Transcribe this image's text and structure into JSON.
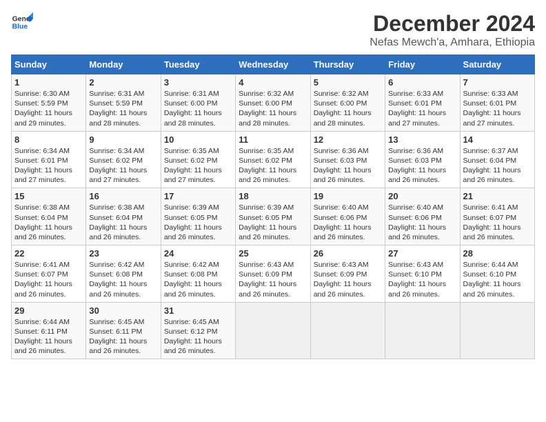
{
  "logo": {
    "line1": "General",
    "line2": "Blue"
  },
  "title": "December 2024",
  "subtitle": "Nefas Mewch'a, Amhara, Ethiopia",
  "days_of_week": [
    "Sunday",
    "Monday",
    "Tuesday",
    "Wednesday",
    "Thursday",
    "Friday",
    "Saturday"
  ],
  "weeks": [
    [
      {
        "day": 1,
        "sunrise": "6:30 AM",
        "sunset": "5:59 PM",
        "daylight": "11 hours and 29 minutes"
      },
      {
        "day": 2,
        "sunrise": "6:31 AM",
        "sunset": "5:59 PM",
        "daylight": "11 hours and 28 minutes"
      },
      {
        "day": 3,
        "sunrise": "6:31 AM",
        "sunset": "6:00 PM",
        "daylight": "11 hours and 28 minutes"
      },
      {
        "day": 4,
        "sunrise": "6:32 AM",
        "sunset": "6:00 PM",
        "daylight": "11 hours and 28 minutes"
      },
      {
        "day": 5,
        "sunrise": "6:32 AM",
        "sunset": "6:00 PM",
        "daylight": "11 hours and 28 minutes"
      },
      {
        "day": 6,
        "sunrise": "6:33 AM",
        "sunset": "6:01 PM",
        "daylight": "11 hours and 27 minutes"
      },
      {
        "day": 7,
        "sunrise": "6:33 AM",
        "sunset": "6:01 PM",
        "daylight": "11 hours and 27 minutes"
      }
    ],
    [
      {
        "day": 8,
        "sunrise": "6:34 AM",
        "sunset": "6:01 PM",
        "daylight": "11 hours and 27 minutes"
      },
      {
        "day": 9,
        "sunrise": "6:34 AM",
        "sunset": "6:02 PM",
        "daylight": "11 hours and 27 minutes"
      },
      {
        "day": 10,
        "sunrise": "6:35 AM",
        "sunset": "6:02 PM",
        "daylight": "11 hours and 27 minutes"
      },
      {
        "day": 11,
        "sunrise": "6:35 AM",
        "sunset": "6:02 PM",
        "daylight": "11 hours and 26 minutes"
      },
      {
        "day": 12,
        "sunrise": "6:36 AM",
        "sunset": "6:03 PM",
        "daylight": "11 hours and 26 minutes"
      },
      {
        "day": 13,
        "sunrise": "6:36 AM",
        "sunset": "6:03 PM",
        "daylight": "11 hours and 26 minutes"
      },
      {
        "day": 14,
        "sunrise": "6:37 AM",
        "sunset": "6:04 PM",
        "daylight": "11 hours and 26 minutes"
      }
    ],
    [
      {
        "day": 15,
        "sunrise": "6:38 AM",
        "sunset": "6:04 PM",
        "daylight": "11 hours and 26 minutes"
      },
      {
        "day": 16,
        "sunrise": "6:38 AM",
        "sunset": "6:04 PM",
        "daylight": "11 hours and 26 minutes"
      },
      {
        "day": 17,
        "sunrise": "6:39 AM",
        "sunset": "6:05 PM",
        "daylight": "11 hours and 26 minutes"
      },
      {
        "day": 18,
        "sunrise": "6:39 AM",
        "sunset": "6:05 PM",
        "daylight": "11 hours and 26 minutes"
      },
      {
        "day": 19,
        "sunrise": "6:40 AM",
        "sunset": "6:06 PM",
        "daylight": "11 hours and 26 minutes"
      },
      {
        "day": 20,
        "sunrise": "6:40 AM",
        "sunset": "6:06 PM",
        "daylight": "11 hours and 26 minutes"
      },
      {
        "day": 21,
        "sunrise": "6:41 AM",
        "sunset": "6:07 PM",
        "daylight": "11 hours and 26 minutes"
      }
    ],
    [
      {
        "day": 22,
        "sunrise": "6:41 AM",
        "sunset": "6:07 PM",
        "daylight": "11 hours and 26 minutes"
      },
      {
        "day": 23,
        "sunrise": "6:42 AM",
        "sunset": "6:08 PM",
        "daylight": "11 hours and 26 minutes"
      },
      {
        "day": 24,
        "sunrise": "6:42 AM",
        "sunset": "6:08 PM",
        "daylight": "11 hours and 26 minutes"
      },
      {
        "day": 25,
        "sunrise": "6:43 AM",
        "sunset": "6:09 PM",
        "daylight": "11 hours and 26 minutes"
      },
      {
        "day": 26,
        "sunrise": "6:43 AM",
        "sunset": "6:09 PM",
        "daylight": "11 hours and 26 minutes"
      },
      {
        "day": 27,
        "sunrise": "6:43 AM",
        "sunset": "6:10 PM",
        "daylight": "11 hours and 26 minutes"
      },
      {
        "day": 28,
        "sunrise": "6:44 AM",
        "sunset": "6:10 PM",
        "daylight": "11 hours and 26 minutes"
      }
    ],
    [
      {
        "day": 29,
        "sunrise": "6:44 AM",
        "sunset": "6:11 PM",
        "daylight": "11 hours and 26 minutes"
      },
      {
        "day": 30,
        "sunrise": "6:45 AM",
        "sunset": "6:11 PM",
        "daylight": "11 hours and 26 minutes"
      },
      {
        "day": 31,
        "sunrise": "6:45 AM",
        "sunset": "6:12 PM",
        "daylight": "11 hours and 26 minutes"
      },
      null,
      null,
      null,
      null
    ]
  ]
}
